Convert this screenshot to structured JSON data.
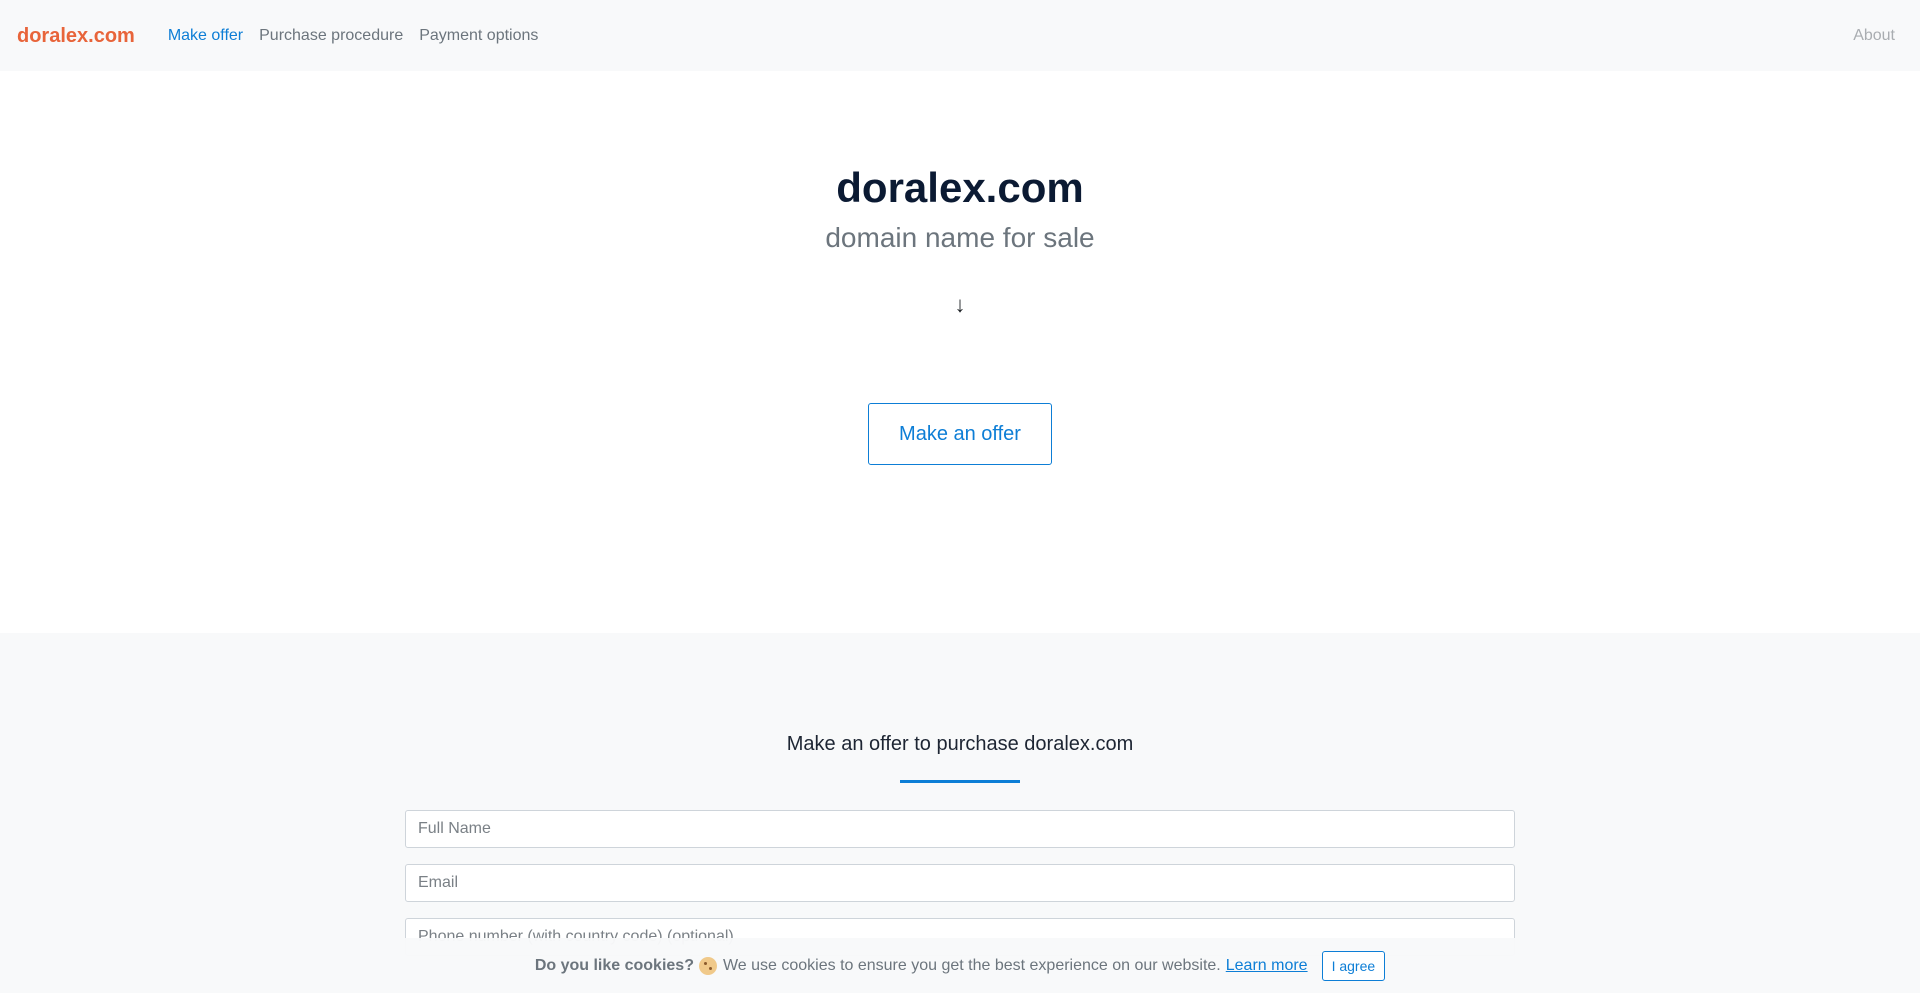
{
  "nav": {
    "brand": "doralex.com",
    "links": [
      {
        "label": "Make offer"
      },
      {
        "label": "Purchase procedure"
      },
      {
        "label": "Payment options"
      }
    ],
    "right_link": "About"
  },
  "hero": {
    "title": "doralex.com",
    "subtitle": "domain name for sale",
    "arrow": "↓",
    "button_label": "Make an offer"
  },
  "form": {
    "title": "Make an offer to purchase doralex.com",
    "fields": {
      "full_name": {
        "placeholder": "Full Name",
        "value": ""
      },
      "email": {
        "placeholder": "Email",
        "value": ""
      },
      "phone": {
        "placeholder": "Phone number (with country code) (optional)",
        "value": ""
      }
    }
  },
  "cookie": {
    "question": "Do you like cookies?",
    "icon": "cookie-icon",
    "text": "We use cookies to ensure you get the best experience on our website.",
    "link": "Learn more",
    "button": "I agree"
  },
  "colors": {
    "brand": "#e8643a",
    "accent": "#0d7ed6",
    "navbar_bg": "#f8f9fa",
    "muted_text": "#6c757d"
  }
}
